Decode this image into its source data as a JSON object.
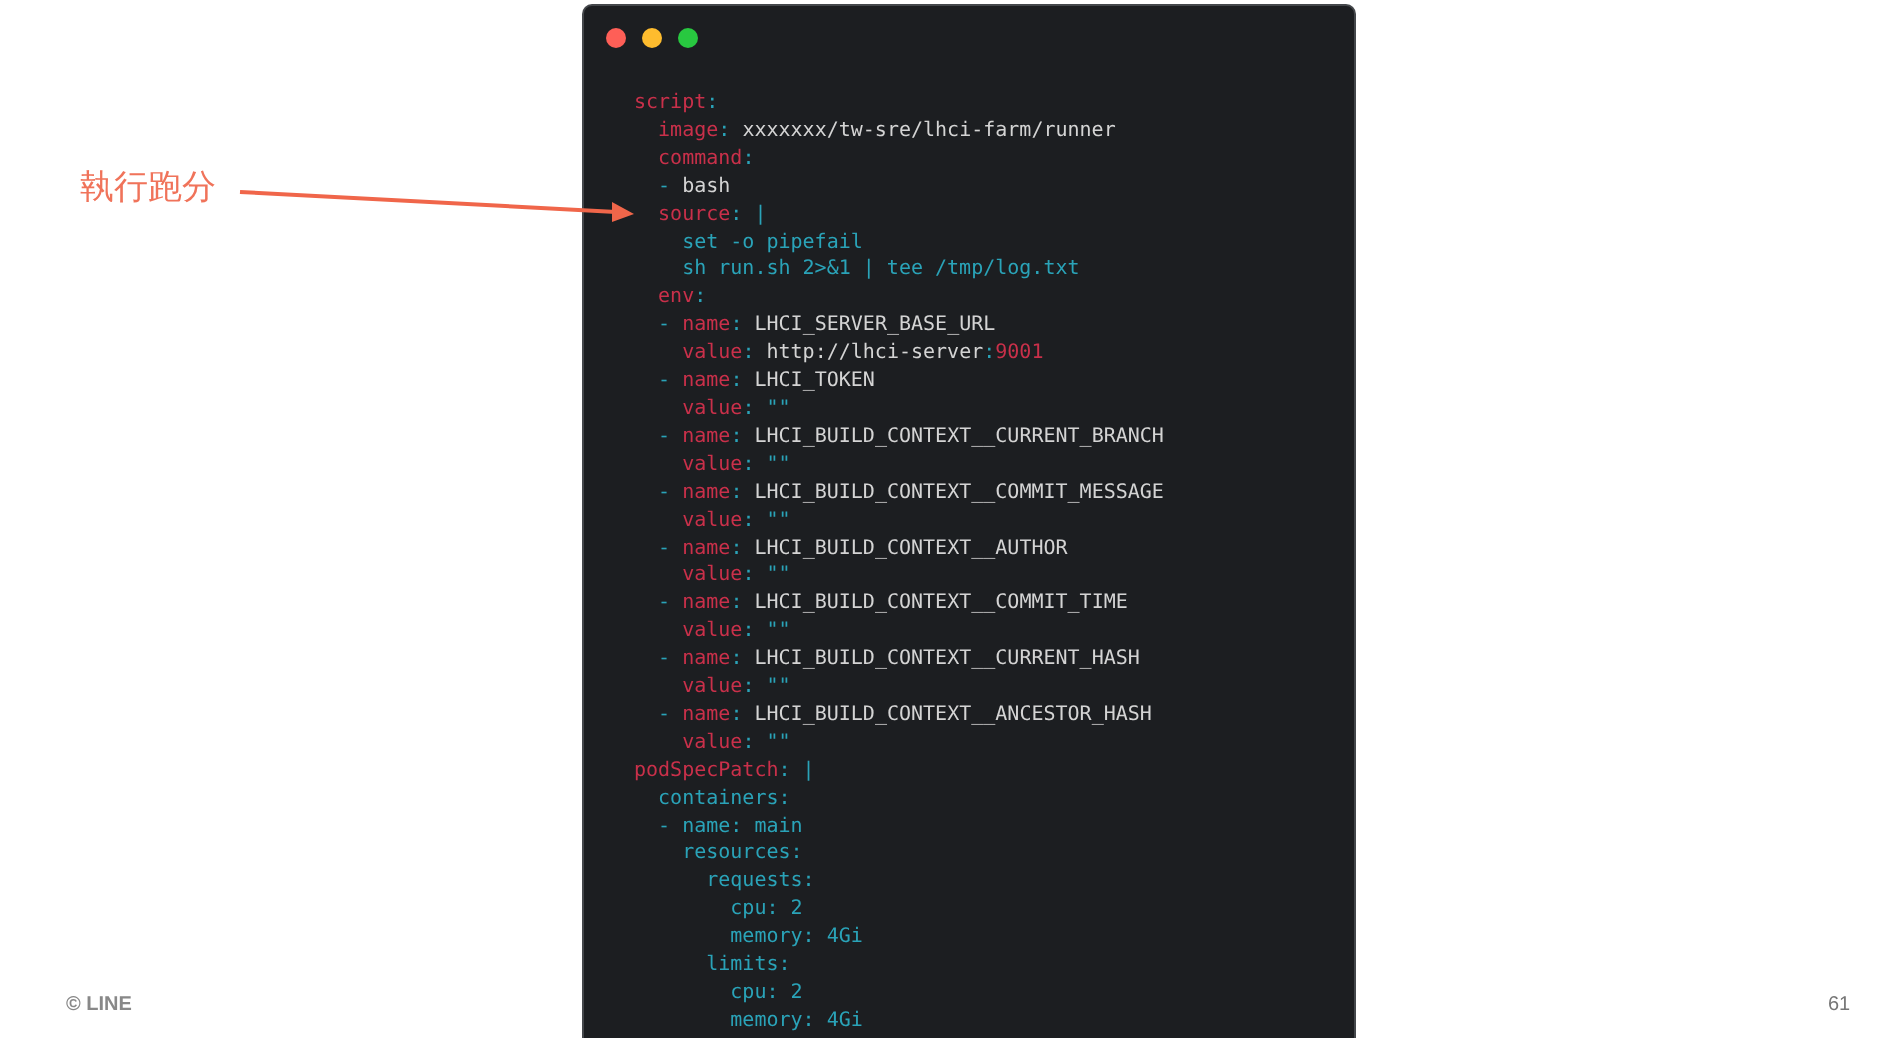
{
  "annotation": {
    "text": "執行跑分"
  },
  "editor": {
    "window_buttons": [
      {
        "color": "#fe5f57"
      },
      {
        "color": "#febc2e"
      },
      {
        "color": "#28c840"
      }
    ],
    "lines": [
      [
        {
          "kind": "key",
          "text": "script"
        },
        {
          "kind": "punct",
          "text": ":"
        }
      ],
      [
        {
          "kind": "key",
          "text": "  image"
        },
        {
          "kind": "punct",
          "text": ":"
        },
        {
          "kind": "plain",
          "text": " xxxxxxx/tw-sre/lhci-farm/runner"
        }
      ],
      [
        {
          "kind": "key",
          "text": "  command"
        },
        {
          "kind": "punct",
          "text": ":"
        }
      ],
      [
        {
          "kind": "punct",
          "text": "  - "
        },
        {
          "kind": "plain",
          "text": "bash"
        }
      ],
      [
        {
          "kind": "key",
          "text": "  source"
        },
        {
          "kind": "punct",
          "text": ": |"
        }
      ],
      [
        {
          "kind": "punct",
          "text": "    set -o pipefail"
        }
      ],
      [
        {
          "kind": "punct",
          "text": "    sh run.sh 2>&1 | tee /tmp/log.txt"
        }
      ],
      [
        {
          "kind": "key",
          "text": "  env"
        },
        {
          "kind": "punct",
          "text": ":"
        }
      ],
      [
        {
          "kind": "punct",
          "text": "  - "
        },
        {
          "kind": "key",
          "text": "name"
        },
        {
          "kind": "punct",
          "text": ":"
        },
        {
          "kind": "plain",
          "text": " LHCI_SERVER_BASE_URL"
        }
      ],
      [
        {
          "kind": "key",
          "text": "    value"
        },
        {
          "kind": "punct",
          "text": ":"
        },
        {
          "kind": "plain",
          "text": " http://lhci-server"
        },
        {
          "kind": "punct",
          "text": ":"
        },
        {
          "kind": "key",
          "text": "9001"
        }
      ],
      [
        {
          "kind": "punct",
          "text": "  - "
        },
        {
          "kind": "key",
          "text": "name"
        },
        {
          "kind": "punct",
          "text": ":"
        },
        {
          "kind": "plain",
          "text": " LHCI_TOKEN"
        }
      ],
      [
        {
          "kind": "key",
          "text": "    value"
        },
        {
          "kind": "punct",
          "text": ": \"\""
        }
      ],
      [
        {
          "kind": "punct",
          "text": "  - "
        },
        {
          "kind": "key",
          "text": "name"
        },
        {
          "kind": "punct",
          "text": ":"
        },
        {
          "kind": "plain",
          "text": " LHCI_BUILD_CONTEXT__CURRENT_BRANCH"
        }
      ],
      [
        {
          "kind": "key",
          "text": "    value"
        },
        {
          "kind": "punct",
          "text": ": \"\""
        }
      ],
      [
        {
          "kind": "punct",
          "text": "  - "
        },
        {
          "kind": "key",
          "text": "name"
        },
        {
          "kind": "punct",
          "text": ":"
        },
        {
          "kind": "plain",
          "text": " LHCI_BUILD_CONTEXT__COMMIT_MESSAGE"
        }
      ],
      [
        {
          "kind": "key",
          "text": "    value"
        },
        {
          "kind": "punct",
          "text": ": \"\""
        }
      ],
      [
        {
          "kind": "punct",
          "text": "  - "
        },
        {
          "kind": "key",
          "text": "name"
        },
        {
          "kind": "punct",
          "text": ":"
        },
        {
          "kind": "plain",
          "text": " LHCI_BUILD_CONTEXT__AUTHOR"
        }
      ],
      [
        {
          "kind": "key",
          "text": "    value"
        },
        {
          "kind": "punct",
          "text": ": \"\""
        }
      ],
      [
        {
          "kind": "punct",
          "text": "  - "
        },
        {
          "kind": "key",
          "text": "name"
        },
        {
          "kind": "punct",
          "text": ":"
        },
        {
          "kind": "plain",
          "text": " LHCI_BUILD_CONTEXT__COMMIT_TIME"
        }
      ],
      [
        {
          "kind": "key",
          "text": "    value"
        },
        {
          "kind": "punct",
          "text": ": \"\""
        }
      ],
      [
        {
          "kind": "punct",
          "text": "  - "
        },
        {
          "kind": "key",
          "text": "name"
        },
        {
          "kind": "punct",
          "text": ":"
        },
        {
          "kind": "plain",
          "text": " LHCI_BUILD_CONTEXT__CURRENT_HASH"
        }
      ],
      [
        {
          "kind": "key",
          "text": "    value"
        },
        {
          "kind": "punct",
          "text": ": \"\""
        }
      ],
      [
        {
          "kind": "punct",
          "text": "  - "
        },
        {
          "kind": "key",
          "text": "name"
        },
        {
          "kind": "punct",
          "text": ":"
        },
        {
          "kind": "plain",
          "text": " LHCI_BUILD_CONTEXT__ANCESTOR_HASH"
        }
      ],
      [
        {
          "kind": "key",
          "text": "    value"
        },
        {
          "kind": "punct",
          "text": ": \"\""
        }
      ],
      [
        {
          "kind": "key",
          "text": "podSpecPatch"
        },
        {
          "kind": "punct",
          "text": ": |"
        }
      ],
      [
        {
          "kind": "punct",
          "text": "  containers:"
        }
      ],
      [
        {
          "kind": "punct",
          "text": "  - name: main"
        }
      ],
      [
        {
          "kind": "punct",
          "text": "    resources:"
        }
      ],
      [
        {
          "kind": "punct",
          "text": "      requests:"
        }
      ],
      [
        {
          "kind": "punct",
          "text": "        cpu: 2"
        }
      ],
      [
        {
          "kind": "punct",
          "text": "        memory: 4Gi"
        }
      ],
      [
        {
          "kind": "punct",
          "text": "      limits:"
        }
      ],
      [
        {
          "kind": "punct",
          "text": "        cpu: 2"
        }
      ],
      [
        {
          "kind": "punct",
          "text": "        memory: 4Gi"
        }
      ]
    ]
  },
  "footer": {
    "copyright": "© LINE",
    "page_number": "61"
  }
}
